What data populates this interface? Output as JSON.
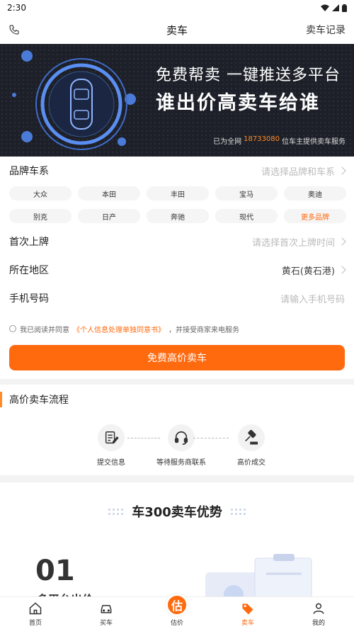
{
  "status_bar": {
    "time": "2:30"
  },
  "header": {
    "title": "卖车",
    "right_link": "卖车记录"
  },
  "banner": {
    "line1": "免费帮卖 一键推送多平台",
    "line2": "谁出价高卖车给谁",
    "sub_prefix": "已为全网",
    "sub_number": "18733080",
    "sub_suffix": "位车主提供卖车服务"
  },
  "form": {
    "brand_label": "品牌车系",
    "brand_placeholder": "请选择品牌和车系",
    "brands": [
      "大众",
      "本田",
      "丰田",
      "宝马",
      "奥迪",
      "别克",
      "日产",
      "奔驰",
      "现代"
    ],
    "more_brands": "更多品牌",
    "first_reg_label": "首次上牌",
    "first_reg_placeholder": "请选择首次上牌时间",
    "region_label": "所在地区",
    "region_value": "黄石(黄石港)",
    "phone_label": "手机号码",
    "phone_placeholder": "请输入手机号码",
    "agree_prefix": "我已阅读并同意",
    "agree_link": "《个人信息处理单独同意书》",
    "agree_suffix": "，并接受商家来电服务",
    "submit_label": "免费高价卖车"
  },
  "process": {
    "title": "高价卖车流程",
    "steps": [
      "提交信息",
      "等待服务商联系",
      "高价成交"
    ]
  },
  "advantages": {
    "title": "车300卖车优势",
    "item_number": "01",
    "item_text": "多平台出价"
  },
  "tabbar": {
    "items": [
      "首页",
      "买车",
      "估价",
      "卖车",
      "我的"
    ],
    "center_badge": "估",
    "active_color": "#ff6a0f"
  }
}
